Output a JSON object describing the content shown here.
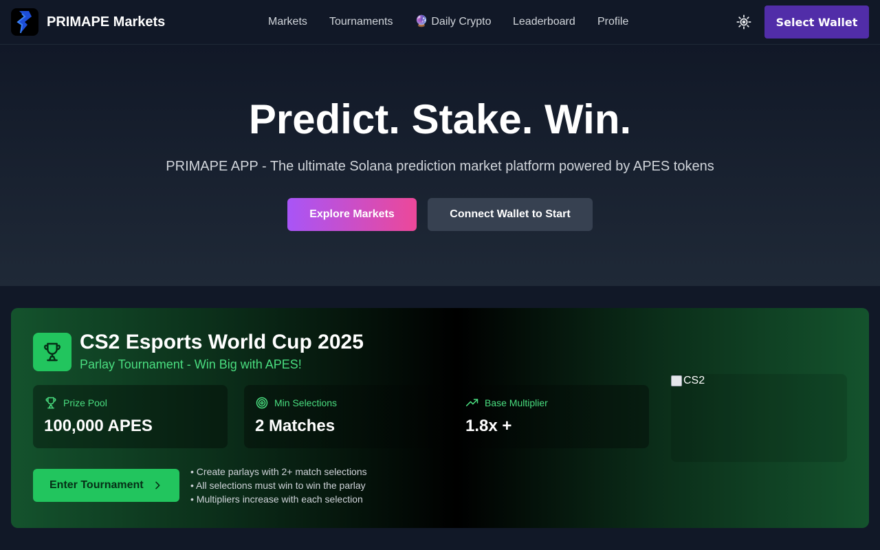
{
  "header": {
    "brand": "PRIMAPE Markets",
    "nav": [
      {
        "label": "Markets"
      },
      {
        "label": "Tournaments"
      },
      {
        "label": "🔮 Daily Crypto"
      },
      {
        "label": "Leaderboard"
      },
      {
        "label": "Profile"
      }
    ],
    "theme_icon": "sun-icon",
    "wallet_button": "Select Wallet"
  },
  "hero": {
    "title": "Predict. Stake. Win.",
    "subtitle": "PRIMAPE APP - The ultimate Solana prediction market platform powered by APES tokens",
    "explore_button": "Explore Markets",
    "connect_button": "Connect Wallet to Start"
  },
  "tournament": {
    "title": "CS2 Esports World Cup 2025",
    "subtitle": "Parlay Tournament - Win Big with APES!",
    "stats": [
      {
        "label": "Prize Pool",
        "value": "100,000 APES",
        "icon": "trophy-icon"
      },
      {
        "label": "Min Selections",
        "value": "2 Matches",
        "icon": "target-icon"
      },
      {
        "label": "Base Multiplier",
        "value": "1.8x +",
        "icon": "trending-up-icon"
      }
    ],
    "image_alt": "CS2",
    "enter_button": "Enter Tournament",
    "rules": [
      "• Create parlays with 2+ match selections",
      "• All selections must win to win the parlay",
      "• Multipliers increase with each selection"
    ]
  },
  "colors": {
    "background": "#111827",
    "accent_purple": "#512da8",
    "accent_green": "#22c55e",
    "green_text": "#4ade80"
  }
}
